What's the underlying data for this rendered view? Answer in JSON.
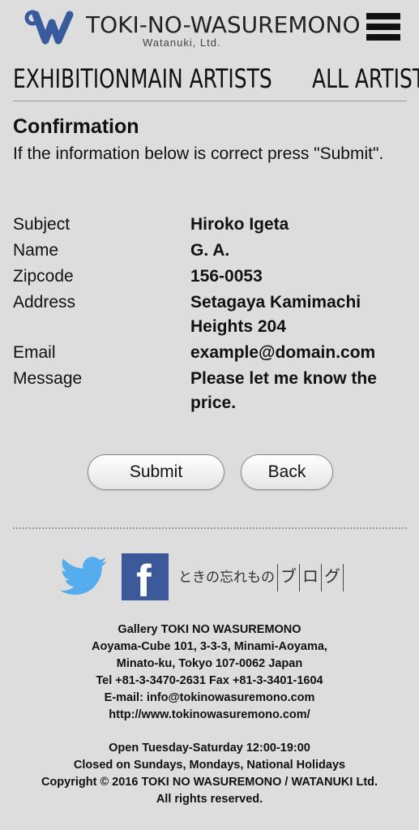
{
  "header": {
    "logo_title": "TOKI-NO-WASUREMONO",
    "logo_subtitle": "Watanuki, Ltd."
  },
  "nav": {
    "items": [
      {
        "label": "EXHIBITION"
      },
      {
        "label": "MAIN ARTISTS"
      },
      {
        "label": "ALL ARTISTS"
      }
    ]
  },
  "confirmation": {
    "title": "Confirmation",
    "intro": "If the information below is correct press \"Submit\".",
    "fields": [
      {
        "label": "Subject",
        "value": "Hiroko Igeta"
      },
      {
        "label": "Name",
        "value": "G. A."
      },
      {
        "label": "Zipcode",
        "value": "156-0053"
      },
      {
        "label": "Address",
        "value": "Setagaya Kamimachi Heights 204"
      },
      {
        "label": "Email",
        "value": "example@domain.com"
      },
      {
        "label": "Message",
        "value": "Please let me know the price."
      }
    ],
    "submit_label": "Submit",
    "back_label": "Back"
  },
  "social": {
    "twitter_icon": "twitter-icon",
    "facebook_icon": "facebook-icon",
    "blog_label_main": "ときの忘れもの",
    "blog_label_chars": [
      "ブ",
      "ロ",
      "グ"
    ]
  },
  "footer": {
    "lines": [
      "Gallery TOKI NO WASUREMONO",
      "Aoyama-Cube 101, 3-3-3, Minami-Aoyama,",
      "Minato-ku, Tokyo 107-0062 Japan",
      "Tel +81-3-3470-2631 Fax +81-3-3401-1604",
      "E-mail: info@tokinowasuremono.com",
      "http://www.tokinowasuremono.com/"
    ],
    "hours": "Open Tuesday-Saturday 12:00-19:00",
    "closed": "Closed on Sundays, Mondays, National Holidays",
    "copyright": "Copyright © 2016 TOKI NO WASUREMONO / WATANUKI Ltd.",
    "rights": "All rights reserved."
  },
  "colors": {
    "background": "#dddddd",
    "logo_blue": "#3a5a9e",
    "twitter_blue": "#55acee",
    "facebook_blue": "#3b5998"
  }
}
